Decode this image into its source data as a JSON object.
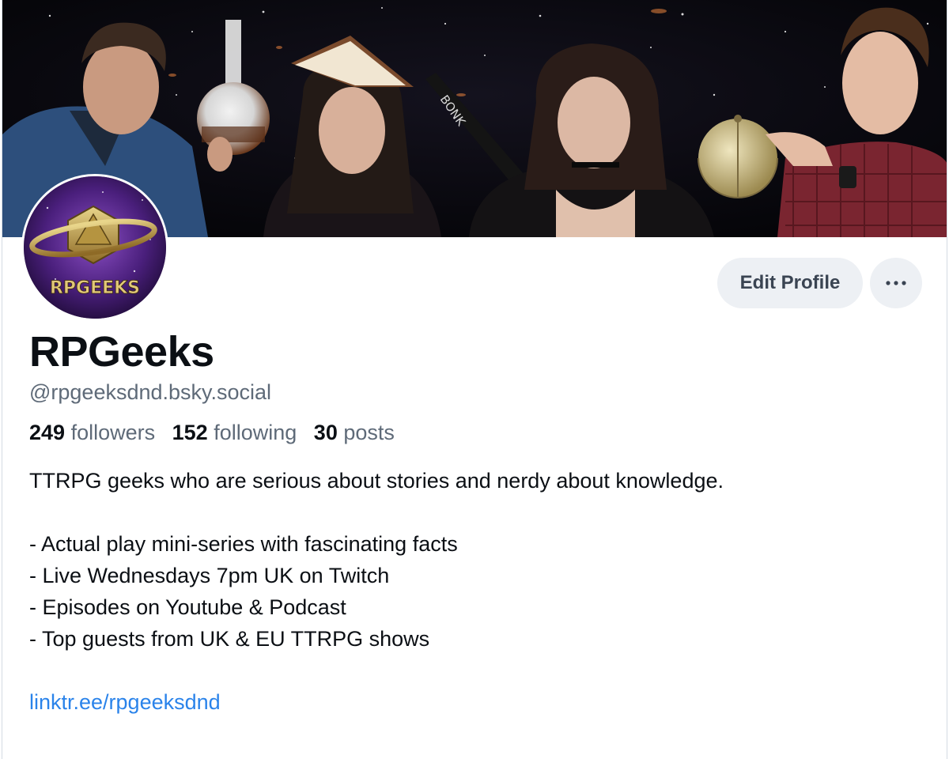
{
  "profile": {
    "display_name": "RPGeeks",
    "handle": "@rpgeeksdnd.bsky.social",
    "avatar_text": "RPGEEKS"
  },
  "actions": {
    "edit_profile_label": "Edit Profile",
    "more_icon": "ellipsis-icon"
  },
  "stats": {
    "followers_count": "249",
    "followers_label": "followers",
    "following_count": "152",
    "following_label": "following",
    "posts_count": "30",
    "posts_label": "posts"
  },
  "bio": {
    "intro": "TTRPG geeks who are serious about stories and nerdy about knowledge.",
    "items": [
      "- Actual play mini-series with fascinating facts",
      "- Live Wednesdays 7pm UK on Twitch",
      "- Episodes on Youtube & Podcast",
      "- Top guests from UK & EU TTRPG shows"
    ],
    "link": "linktr.ee/rpgeeksdnd"
  },
  "colors": {
    "link": "#2a83ea",
    "muted_text": "#5e6a78",
    "button_bg": "#edf0f4"
  }
}
